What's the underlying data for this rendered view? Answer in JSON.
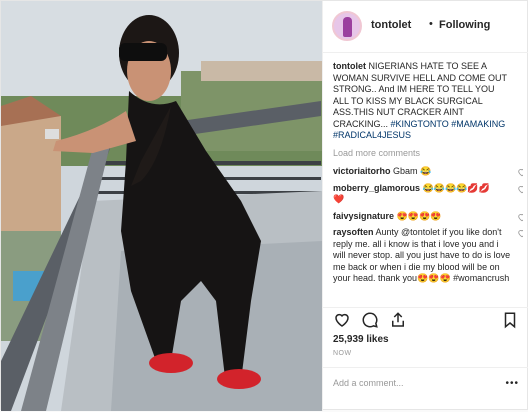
{
  "header": {
    "username": "tontolet",
    "separator": "•",
    "follow_label": "Following"
  },
  "caption": {
    "username": "tontolet",
    "text": "NIGERIANS HATE TO SEE A WOMAN SURVIVE HELL AND COME OUT STRONG.. And IM HERE TO TELL YOU ALL TO KISS MY BLACK SURGICAL ASS.THIS NUT CRACKER AINT CRACKING...",
    "hashtags": "#KINGTONTO #MAMAKING #RADICAL4JESUS"
  },
  "load_more": "Load more comments",
  "comments": [
    {
      "username": "victoriaitorho",
      "text": "Gbam 😂"
    },
    {
      "username": "moberry_glamorous",
      "text": "😂😂😂😂💋💋"
    },
    {
      "username": "",
      "text": "❤️"
    },
    {
      "username": "faivysignature",
      "text": "😍😍😍😍"
    },
    {
      "username": "raysoften",
      "text": "Aunty @tontolet if you like don't reply me. all i know is that i love you and i will never stop. all you just have to do is love me back or when i die my blood will be on your head. thank you😍😍😍 #womancrush"
    }
  ],
  "likes": "25,939 likes",
  "date": "NOW",
  "add_comment_placeholder": "Add a comment...",
  "more_icon": "•••",
  "icons": [
    "heart-icon",
    "comment-icon",
    "share-icon",
    "bookmark-icon"
  ]
}
